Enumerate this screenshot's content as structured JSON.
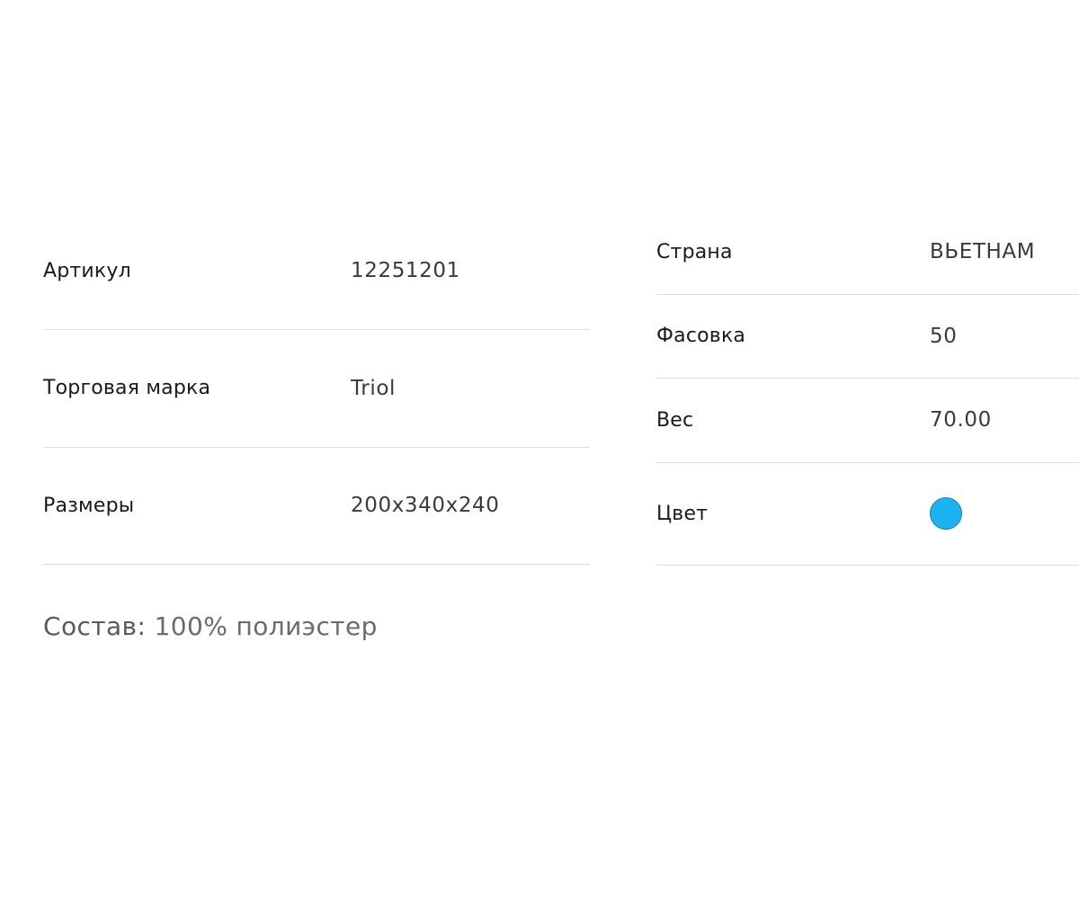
{
  "specs_left": [
    {
      "label": "Артикул",
      "value": "12251201"
    },
    {
      "label": "Торговая марка",
      "value": "Triol"
    },
    {
      "label": "Размеры",
      "value": "200x340x240"
    }
  ],
  "specs_right": {
    "country": {
      "label": "Страна",
      "value": "ВЬЕТНАМ"
    },
    "package": {
      "label": "Фасовка",
      "value": "50"
    },
    "weight": {
      "label": "Вес",
      "value": "70.00"
    },
    "color": {
      "label": "Цвет",
      "swatch_color": "#1ab2f0"
    }
  },
  "composition": {
    "label": "Состав:",
    "value": "100% полиэстер"
  }
}
